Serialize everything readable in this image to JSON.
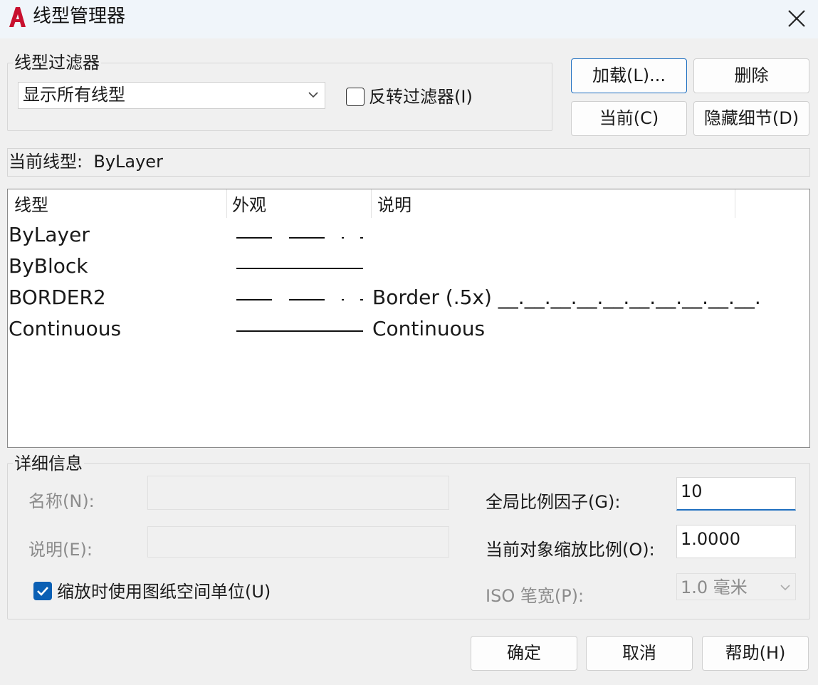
{
  "window": {
    "title": "线型管理器"
  },
  "filter": {
    "legend": "线型过滤器",
    "selected": "显示所有线型",
    "invert_label": "反转过滤器(I)",
    "invert_checked": false
  },
  "buttons": {
    "load": "加载(L)...",
    "delete": "删除",
    "current": "当前(C)",
    "hide_details": "隐藏细节(D)",
    "ok": "确定",
    "cancel": "取消",
    "help": "帮助(H)"
  },
  "current_linetype": {
    "label": "当前线型:",
    "value": "ByLayer"
  },
  "list": {
    "columns": [
      "线型",
      "外观",
      "说明"
    ],
    "rows": [
      {
        "name": "ByLayer",
        "appearance": "dash-dot",
        "description": ""
      },
      {
        "name": "ByBlock",
        "appearance": "continuous",
        "description": ""
      },
      {
        "name": "BORDER2",
        "appearance": "dash-dot",
        "description": "Border (.5x) __.__.__.__.__.__.__.__.__.__."
      },
      {
        "name": "Continuous",
        "appearance": "continuous",
        "description": "Continuous"
      }
    ]
  },
  "details": {
    "legend": "详细信息",
    "name_label": "名称(N):",
    "name_value": "",
    "desc_label": "说明(E):",
    "desc_value": "",
    "paper_space_label": "缩放时使用图纸空间单位(U)",
    "paper_space_checked": true,
    "global_scale_label": "全局比例因子(G):",
    "global_scale_value": "10",
    "object_scale_label": "当前对象缩放比例(O):",
    "object_scale_value": "1.0000",
    "iso_pen_label": "ISO 笔宽(P):",
    "iso_pen_value": "1.0 毫米"
  },
  "colors": {
    "accent": "#1e6fc0",
    "check": "#0a5fb4",
    "app_icon": "#c8102e"
  }
}
